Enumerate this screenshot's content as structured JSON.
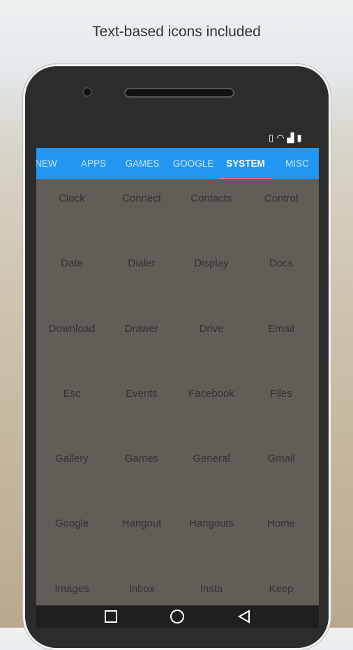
{
  "caption": "Text-based icons included",
  "status_icons": [
    "vibrate-icon",
    "wifi-icon",
    "signal-icon",
    "battery-icon"
  ],
  "tabs": [
    {
      "label": "NEW"
    },
    {
      "label": "APPS"
    },
    {
      "label": "GAMES"
    },
    {
      "label": "GOOGLE"
    },
    {
      "label": "SYSTEM",
      "active": true
    },
    {
      "label": "MISC"
    }
  ],
  "accent": "#2196f3",
  "icons": [
    "Clock",
    "Connect",
    "Contacts",
    "Control",
    "Date",
    "Dialer",
    "Display",
    "Docs",
    "Download",
    "Drawer",
    "Drive",
    "Email",
    "Esc",
    "Events",
    "Facebook",
    "Files",
    "Gallery",
    "Games",
    "General",
    "Gmail",
    "Google",
    "Hangout",
    "Hangouts",
    "Home",
    "Images",
    "Inbox",
    "Insta",
    "Keep"
  ],
  "nav": [
    "recents-icon",
    "home-icon",
    "back-icon"
  ]
}
